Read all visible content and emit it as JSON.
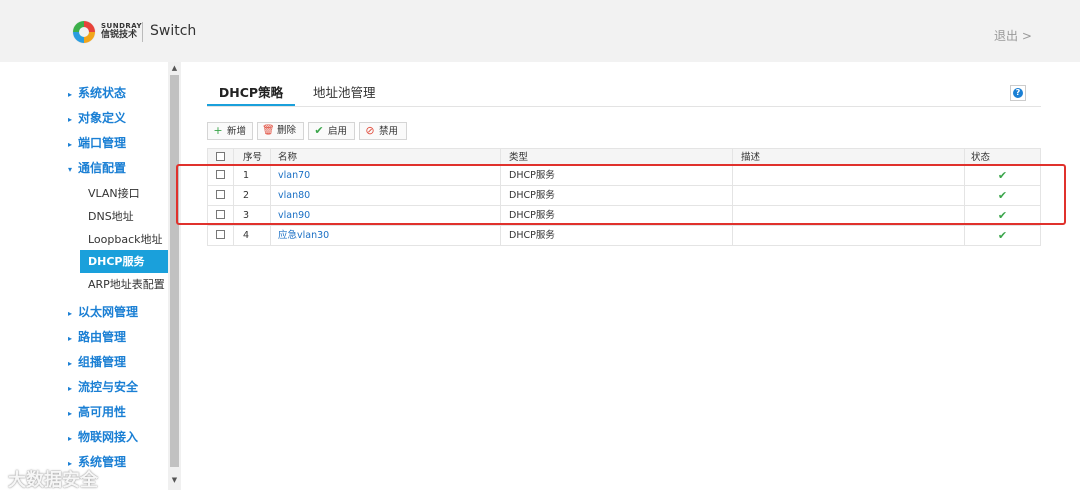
{
  "header": {
    "brand_en": "SUNDRAY",
    "brand_cn": "信锐技术",
    "app_title": "Switch",
    "logout": "退出 >"
  },
  "sidebar": {
    "items": [
      {
        "label": "系统状态",
        "arrow": "▸"
      },
      {
        "label": "对象定义",
        "arrow": "▸"
      },
      {
        "label": "端口管理",
        "arrow": "▸"
      },
      {
        "label": "通信配置",
        "arrow": "▾"
      },
      {
        "label": "以太网管理",
        "arrow": "▸"
      },
      {
        "label": "路由管理",
        "arrow": "▸"
      },
      {
        "label": "组播管理",
        "arrow": "▸"
      },
      {
        "label": "流控与安全",
        "arrow": "▸"
      },
      {
        "label": "高可用性",
        "arrow": "▸"
      },
      {
        "label": "物联网接入",
        "arrow": "▸"
      },
      {
        "label": "系统管理",
        "arrow": "▸"
      }
    ],
    "sub_items": [
      {
        "label": "VLAN接口"
      },
      {
        "label": "DNS地址"
      },
      {
        "label": "Loopback地址"
      },
      {
        "label": "DHCP服务",
        "active": true
      },
      {
        "label": "ARP地址表配置"
      }
    ]
  },
  "tabs": [
    {
      "label": "DHCP策略",
      "active": true
    },
    {
      "label": "地址池管理"
    }
  ],
  "help_label": "?",
  "toolbar": {
    "add": "新增",
    "delete": "删除",
    "enable": "启用",
    "disable": "禁用"
  },
  "table": {
    "headers": {
      "no": "序号",
      "name": "名称",
      "type": "类型",
      "desc": "描述",
      "status": "状态"
    },
    "rows": [
      {
        "no": "1",
        "name": "vlan70",
        "type": "DHCP服务",
        "desc": "",
        "status": "✔"
      },
      {
        "no": "2",
        "name": "vlan80",
        "type": "DHCP服务",
        "desc": "",
        "status": "✔"
      },
      {
        "no": "3",
        "name": "vlan90",
        "type": "DHCP服务",
        "desc": "",
        "status": "✔"
      },
      {
        "no": "4",
        "name": "应急vlan30",
        "type": "DHCP服务",
        "desc": "",
        "status": "✔"
      }
    ]
  },
  "watermark": "大数据安全",
  "colors": {
    "accent": "#1aa0db",
    "nav_text": "#1a7fd4",
    "link": "#1a6fc4",
    "highlight": "#e0312c",
    "check": "#3aa54a"
  }
}
